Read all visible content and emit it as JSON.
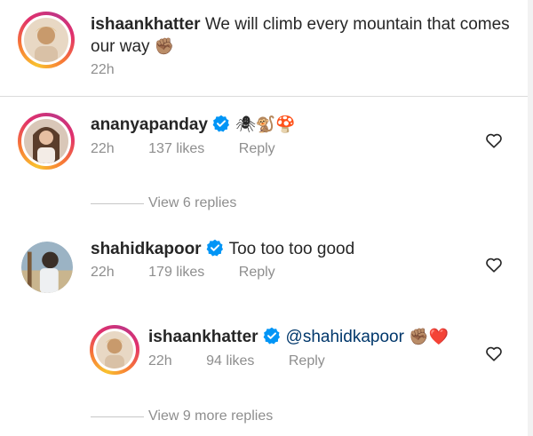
{
  "comments": [
    {
      "username": "ishaankhatter",
      "text_line1": "We will climb every mountain that comes",
      "text_line2": "our way",
      "emoji": "✊🏽",
      "time": "22h",
      "avatar": "ishaan-avatar"
    },
    {
      "username": "ananyapanday",
      "verified": true,
      "emoji": "🕷🐒🍄",
      "time": "22h",
      "likes": "137 likes",
      "reply": "Reply",
      "avatar": "ananya-avatar"
    },
    {
      "username": "shahidkapoor",
      "verified": true,
      "text": "Too too too good",
      "time": "22h",
      "likes": "179 likes",
      "reply": "Reply",
      "avatar": "shahid-avatar"
    }
  ],
  "view_replies_1": "View 6 replies",
  "reply": {
    "username": "ishaankhatter",
    "verified": true,
    "mention": "@shahidkapoor",
    "emoji": "✊🏽❤️",
    "time": "22h",
    "likes": "94 likes",
    "reply": "Reply"
  },
  "view_replies_2": "View 9 more replies",
  "colors": {
    "verified_blue": "#0095f6",
    "meta_gray": "#8e8e8e",
    "mention_blue": "#00376b"
  }
}
